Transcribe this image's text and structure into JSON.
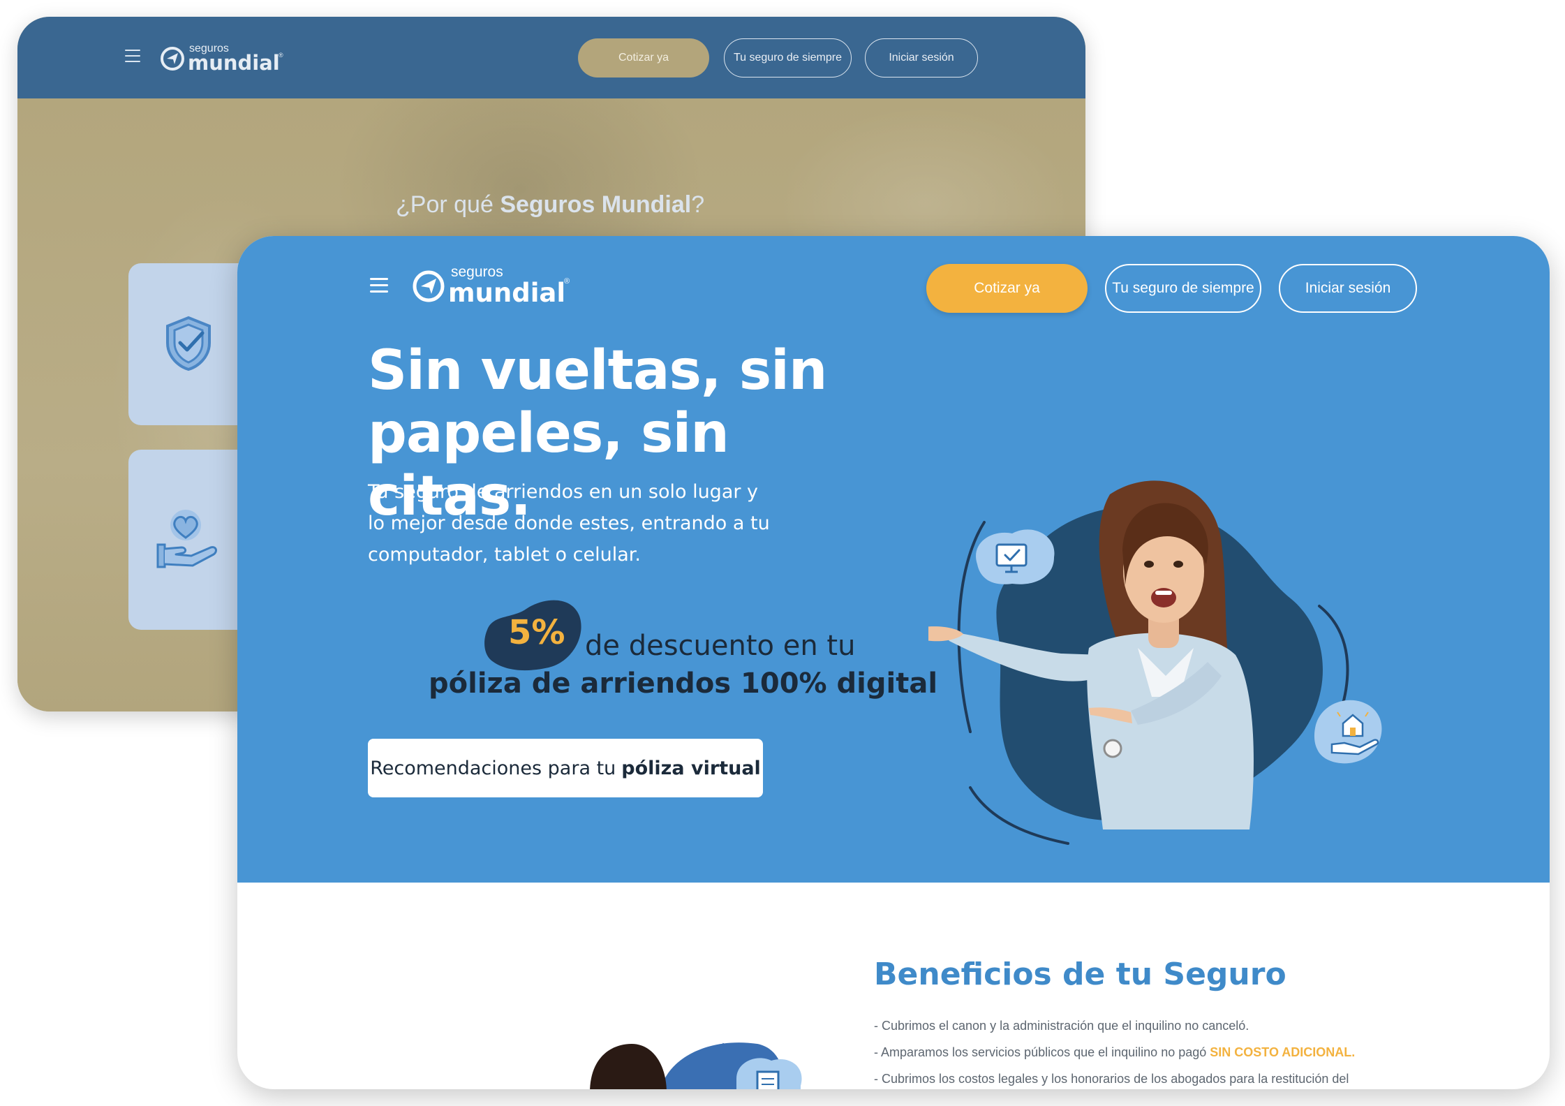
{
  "back": {
    "logo_small": "seguros",
    "logo_big": "mundial",
    "nav": {
      "quote_label": "Cotizar ya",
      "forever_label": "Tu seguro de siempre",
      "login_label": "Iniciar sesión"
    },
    "title_prefix": "¿Por qué ",
    "title_bold": "Seguros Mundial",
    "title_suffix": "?",
    "cards": [
      {
        "icon": "shield-check-icon"
      },
      {
        "icon": "heart-hand-icon"
      }
    ]
  },
  "front": {
    "logo_small": "seguros",
    "logo_big": "mundial",
    "nav": {
      "quote_label": "Cotizar ya",
      "forever_label": "Tu seguro de siempre",
      "login_label": "Iniciar sesión"
    },
    "hero": {
      "title_line1": "Sin vueltas, sin",
      "title_line2": "papeles, sin citas.",
      "subtitle_line1": "Tu seguro de arriendos en un solo lugar y",
      "subtitle_line2": "lo mejor desde donde estes, entrando a tu",
      "subtitle_line3": "computador, tablet o celular.",
      "discount_pct": "5%",
      "discount_line1": "de descuento en tu",
      "discount_line2": "póliza de arriendos 100% digital",
      "reco_prefix": "Recomendaciones para tu",
      "reco_bold": "póliza virtual",
      "icons": [
        "monitor-check-icon",
        "house-hand-icon"
      ]
    },
    "benefits": {
      "title": "Beneficios de tu Seguro",
      "items": [
        {
          "text": "- Cubrimos el canon y la administración que el inquilino no canceló.",
          "highlight": ""
        },
        {
          "text": "- Amparamos los servicios públicos que el inquilino no pagó ",
          "highlight": "SIN COSTO ADICIONAL."
        },
        {
          "text": "- Cubrimos los costos legales y los honorarios de los abogados para la restitución del",
          "highlight": ""
        }
      ]
    }
  },
  "colors": {
    "primary_blue": "#4895d4",
    "dark_blue": "#224d70",
    "accent_yellow": "#f3b23f",
    "back_header": "#3a6791",
    "back_overlay": "#b7ab84"
  }
}
